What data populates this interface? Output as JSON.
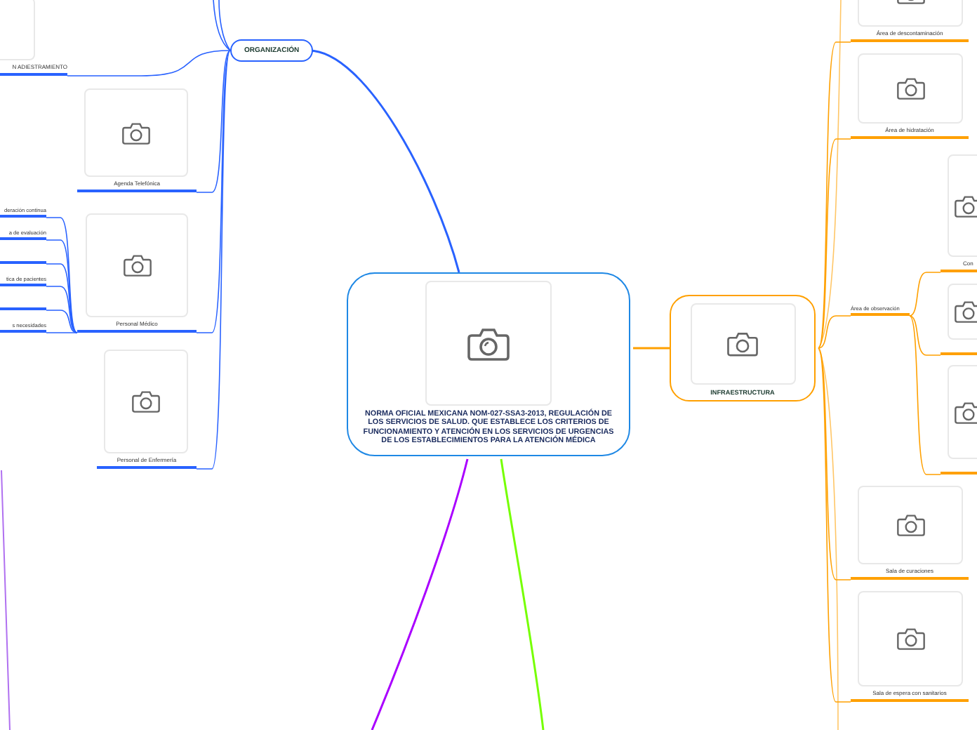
{
  "central_topic": {
    "title": "NORMA OFICIAL MEXICANA NOM-027-SSA3-2013, REGULACIÓN DE LOS SERVICIOS DE SALUD. QUE ESTABLECE LOS CRITERIOS DE FUNCIONAMIENTO Y ATENCIÓN EN LOS SERVICIOS DE URGENCIAS DE LOS ESTABLECIMIENTOS PARA LA ATENCIÓN MÉDICA"
  },
  "branches": [
    {
      "label": "ORGANIZACIÓN",
      "color": "#2962ff",
      "children": [
        {
          "kind": "image",
          "label": "N ADIESTRAMIENTO"
        },
        {
          "kind": "image",
          "label": "Agenda Telefónica"
        },
        {
          "kind": "image",
          "label": "Personal Médico",
          "children": [
            {
              "kind": "text",
              "label": "deración continua"
            },
            {
              "kind": "text",
              "label": "a de evaluación"
            },
            {
              "kind": "text"
            },
            {
              "kind": "text",
              "label": "tica de pacientes"
            },
            {
              "kind": "text"
            },
            {
              "kind": "text",
              "label": "s necesidades"
            }
          ]
        },
        {
          "kind": "image",
          "label": "Personal de Enfermería"
        }
      ]
    },
    {
      "label": "INFRAESTRUCTURA",
      "color": "#ffa000",
      "children": [
        {
          "kind": "image",
          "label": "Área de descontaminación"
        },
        {
          "kind": "image",
          "label": "Área de hidratación"
        },
        {
          "kind": "text",
          "label": "Área de observación",
          "children": [
            {
              "kind": "image",
              "label": "Con"
            },
            {
              "kind": "image"
            },
            {
              "kind": "image"
            }
          ]
        },
        {
          "kind": "image",
          "label": "Sala de curaciones"
        },
        {
          "kind": "image",
          "label": "Sala de espera con sanitarios"
        }
      ]
    }
  ]
}
